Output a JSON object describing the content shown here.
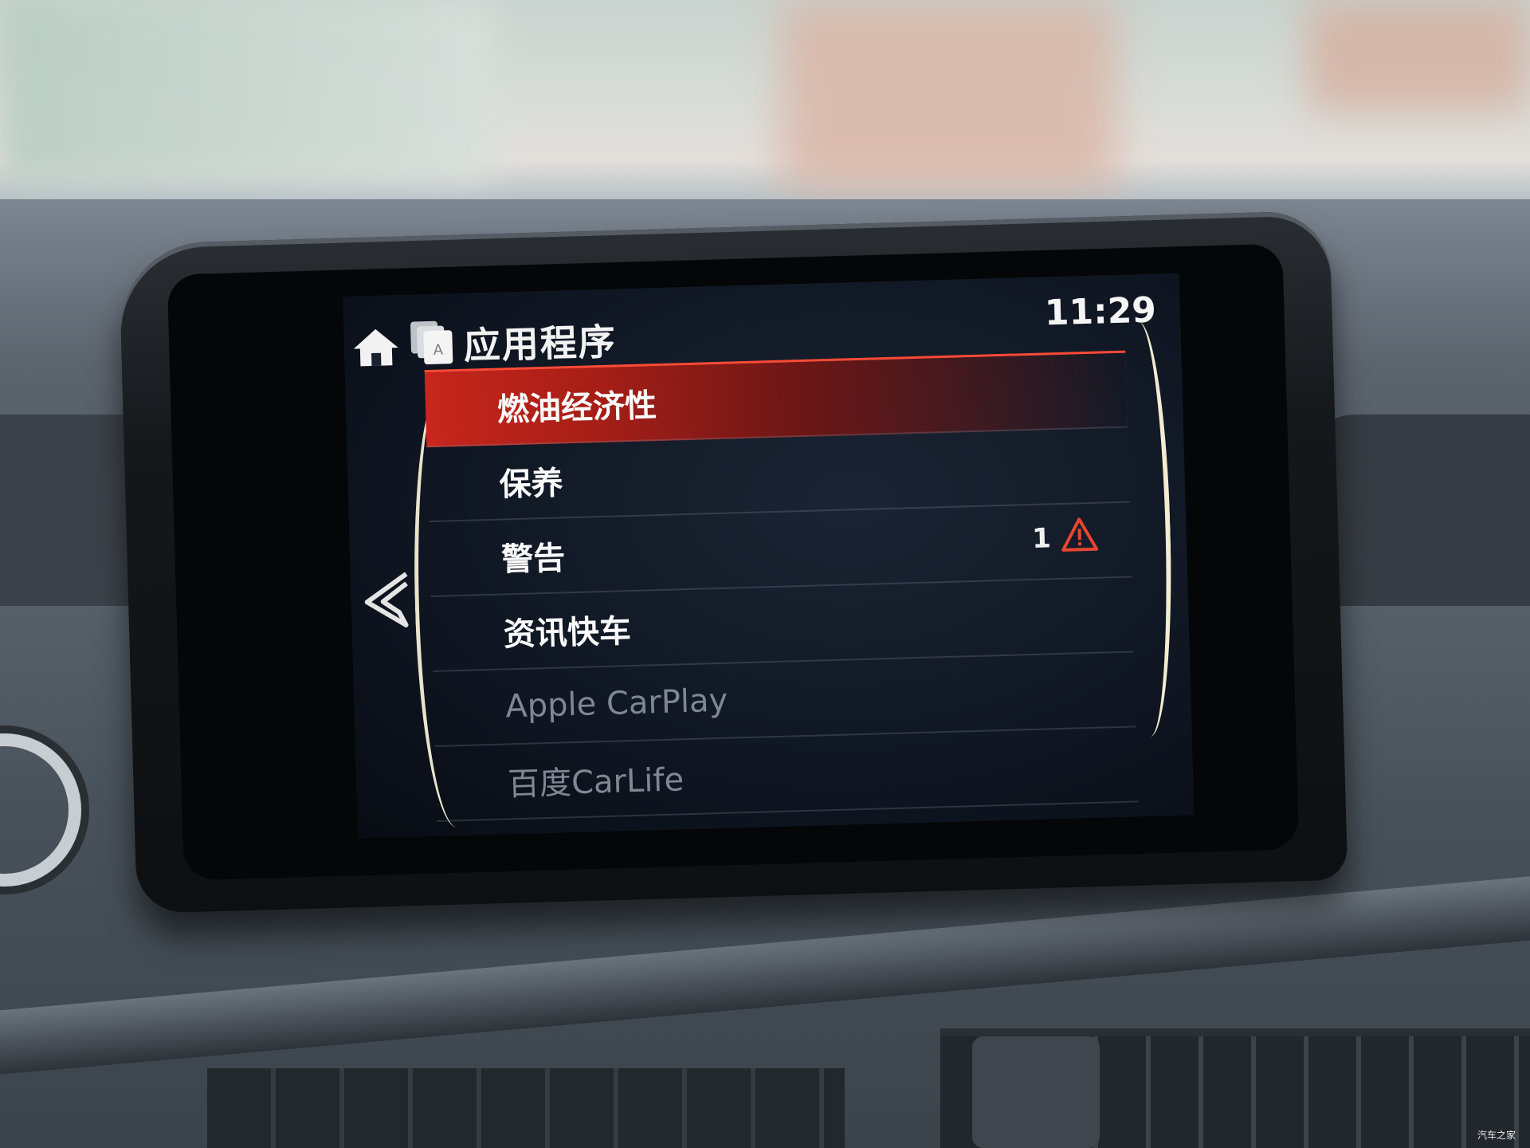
{
  "header": {
    "title": "应用程序",
    "time": "11:29"
  },
  "menu": {
    "items": [
      {
        "label": "燃油经济性",
        "selected": true,
        "enabled": true
      },
      {
        "label": "保养",
        "selected": false,
        "enabled": true
      },
      {
        "label": "警告",
        "selected": false,
        "enabled": true,
        "badge_count": "1",
        "badge_icon": "warning-icon"
      },
      {
        "label": "资讯快车",
        "selected": false,
        "enabled": true
      },
      {
        "label": "Apple CarPlay",
        "selected": false,
        "enabled": false
      },
      {
        "label": "百度CarLife",
        "selected": false,
        "enabled": false
      }
    ]
  },
  "icons": {
    "home": "home-icon",
    "apps": "apps-icon",
    "back": "back-chevron-icon"
  },
  "colors": {
    "selection_red": "#c8261c",
    "warning_red": "#e8452f",
    "accent_line": "#f3ecd2"
  },
  "watermark": "汽车之家"
}
